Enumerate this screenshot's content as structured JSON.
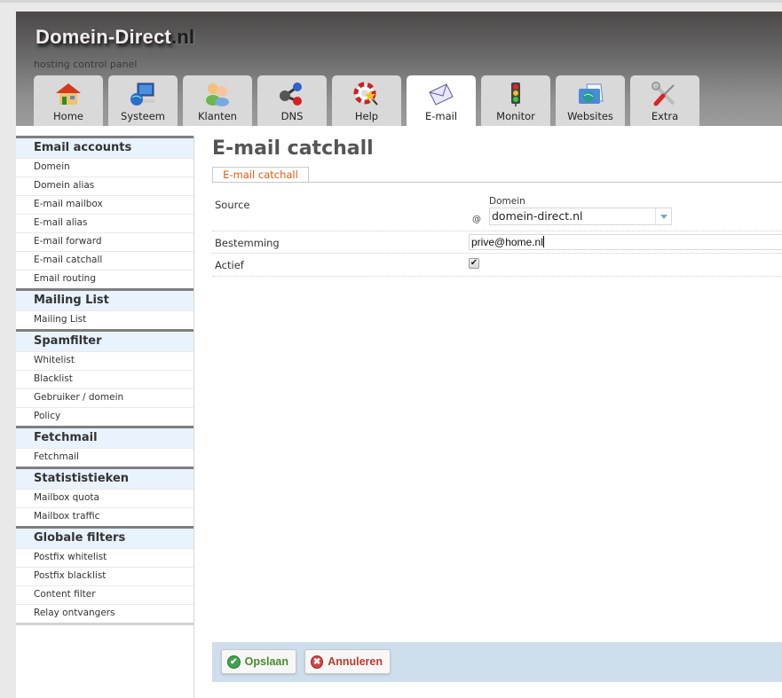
{
  "header": {
    "logo_main": "Domein-Direct",
    "logo_tld": ".nl",
    "subtitle": "hosting control panel"
  },
  "tabs": [
    {
      "label": "Home",
      "icon": "house-icon",
      "active": false
    },
    {
      "label": "Systeem",
      "icon": "computer-globe-icon",
      "active": false
    },
    {
      "label": "Klanten",
      "icon": "users-icon",
      "active": false
    },
    {
      "label": "DNS",
      "icon": "network-nodes-icon",
      "active": false
    },
    {
      "label": "Help",
      "icon": "lifebuoy-icon",
      "active": false
    },
    {
      "label": "E-mail",
      "icon": "envelope-icon",
      "active": true
    },
    {
      "label": "Monitor",
      "icon": "traffic-light-icon",
      "active": false
    },
    {
      "label": "Websites",
      "icon": "folder-globe-icon",
      "active": false
    },
    {
      "label": "Extra",
      "icon": "tools-icon",
      "active": false
    }
  ],
  "sidebar": {
    "sections": [
      {
        "title": "Email accounts",
        "items": [
          "Domein",
          "Domein alias",
          "E-mail mailbox",
          "E-mail alias",
          "E-mail forward",
          "E-mail catchall",
          "Email routing"
        ]
      },
      {
        "title": "Mailing List",
        "items": [
          "Mailing List"
        ]
      },
      {
        "title": "Spamfilter",
        "items": [
          "Whitelist",
          "Blacklist",
          "Gebruiker / domein",
          "Policy"
        ]
      },
      {
        "title": "Fetchmail",
        "items": [
          "Fetchmail"
        ]
      },
      {
        "title": "Statististieken",
        "items": [
          "Mailbox quota",
          "Mailbox traffic"
        ]
      },
      {
        "title": "Globale filters",
        "items": [
          "Postfix whitelist",
          "Postfix blacklist",
          "Content filter",
          "Relay ontvangers"
        ]
      }
    ]
  },
  "main": {
    "title": "E-mail catchall",
    "subtab": "E-mail catchall",
    "form": {
      "source_label": "Source",
      "at_sign": "@",
      "domain_label": "Domein",
      "domain_value": "domein-direct.nl",
      "destination_label": "Bestemming",
      "destination_value": "prive@home.nl",
      "active_label": "Actief",
      "active_checked": true,
      "check_mark": "✔"
    },
    "buttons": {
      "save": "Opslaan",
      "cancel": "Annuleren"
    }
  }
}
